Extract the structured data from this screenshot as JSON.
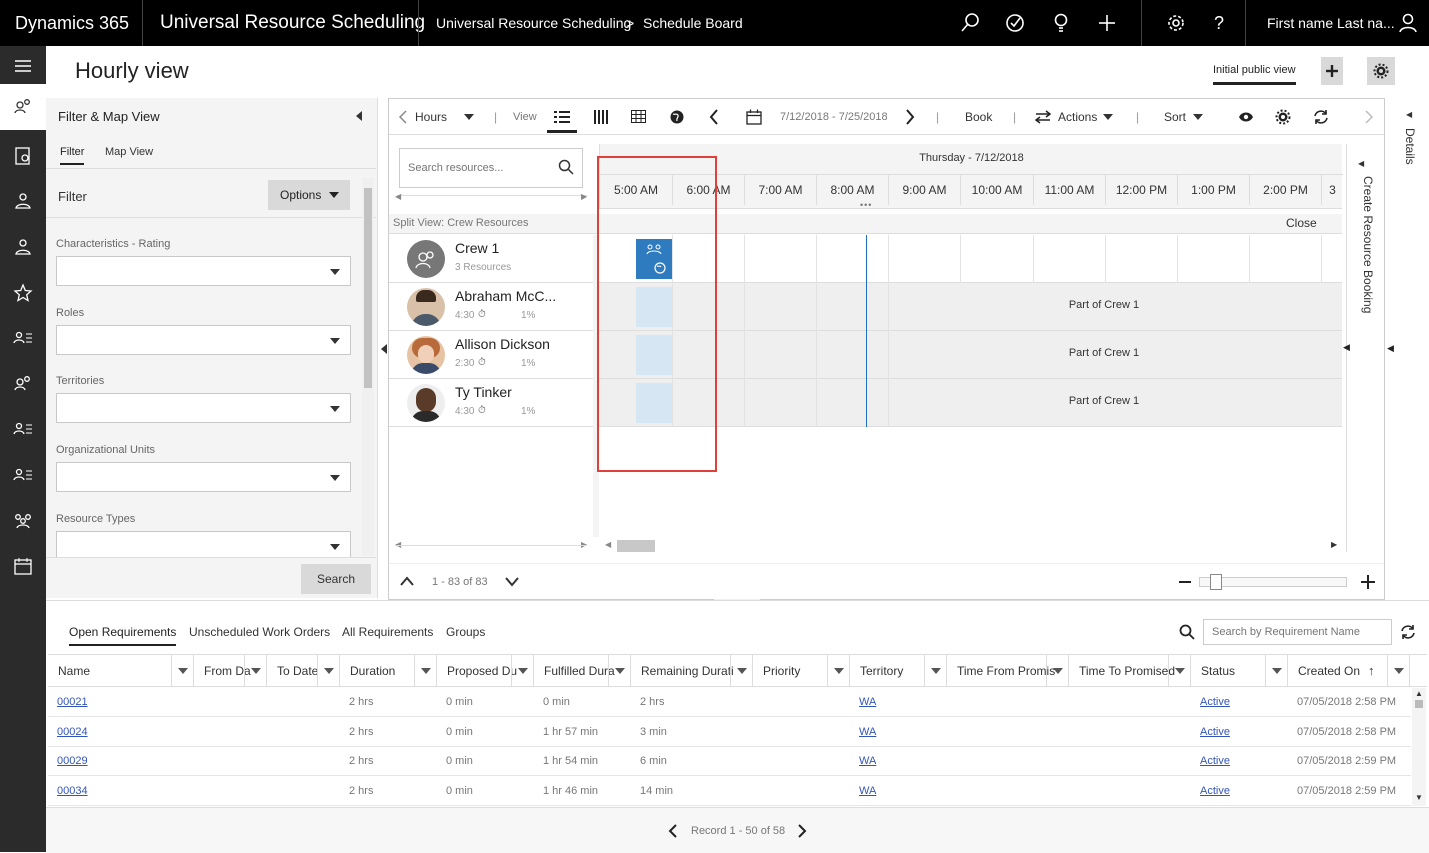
{
  "topbar": {
    "brand": "Dynamics 365",
    "app": "Universal Resource Scheduling",
    "crumb1": "Universal Resource Scheduling",
    "crumb_sep": ">",
    "crumb2": "Schedule Board",
    "user": "First name Last na..."
  },
  "header": {
    "title": "Hourly view",
    "view_tab": "Initial public view"
  },
  "filter_panel": {
    "title": "Filter & Map View",
    "tabs": [
      "Filter",
      "Map View"
    ],
    "filter_label": "Filter",
    "options_label": "Options",
    "fields": [
      "Characteristics - Rating",
      "Roles",
      "Territories",
      "Organizational Units",
      "Resource Types"
    ],
    "search_label": "Search"
  },
  "toolbar": {
    "hours": "Hours",
    "view": "View",
    "date_range": "7/12/2018 - 7/25/2018",
    "book": "Book",
    "actions": "Actions",
    "sort": "Sort"
  },
  "board": {
    "search_placeholder": "Search resources...",
    "date_header": "Thursday - 7/12/2018",
    "hours": [
      "5:00 AM",
      "6:00 AM",
      "7:00 AM",
      "8:00 AM",
      "9:00 AM",
      "10:00 AM",
      "11:00 AM",
      "12:00 PM",
      "1:00 PM",
      "2:00 PM",
      "3"
    ],
    "split_view": "Split View: Crew Resources",
    "close": "Close",
    "resources": [
      {
        "name": "Crew 1",
        "sub": "3 Resources",
        "pct": ""
      },
      {
        "name": "Abraham McC...",
        "sub": "4:30",
        "pct": "1%"
      },
      {
        "name": "Allison Dickson",
        "sub": "2:30",
        "pct": "1%"
      },
      {
        "name": "Ty Tinker",
        "sub": "4:30",
        "pct": "1%"
      }
    ],
    "crew_text": "Part of Crew 1",
    "paging": "1 - 83 of 83",
    "side_panel": "Create Resource Booking",
    "details": "Details"
  },
  "requirements": {
    "tabs": [
      "Open Requirements",
      "Unscheduled Work Orders",
      "All Requirements",
      "Groups"
    ],
    "search_placeholder": "Search by Requirement Name",
    "columns": [
      "Name",
      "From Da",
      "To Date",
      "Duration",
      "Proposed Du",
      "Fulfilled Dura",
      "Remaining Durati",
      "Priority",
      "Territory",
      "Time From Promis",
      "Time To Promised",
      "Status",
      "Created On"
    ],
    "rows": [
      {
        "name": "00021",
        "duration": "2 hrs",
        "proposed": "0 min",
        "fulfilled": "0 min",
        "remaining": "2 hrs",
        "territory": "WA",
        "status": "Active",
        "created": "07/05/2018 2:58 PM"
      },
      {
        "name": "00024",
        "duration": "2 hrs",
        "proposed": "0 min",
        "fulfilled": "1 hr 57 min",
        "remaining": "3 min",
        "territory": "WA",
        "status": "Active",
        "created": "07/05/2018 2:58 PM"
      },
      {
        "name": "00029",
        "duration": "2 hrs",
        "proposed": "0 min",
        "fulfilled": "1 hr 54 min",
        "remaining": "6 min",
        "territory": "WA",
        "status": "Active",
        "created": "07/05/2018 2:59 PM"
      },
      {
        "name": "00034",
        "duration": "2 hrs",
        "proposed": "0 min",
        "fulfilled": "1 hr 46 min",
        "remaining": "14 min",
        "territory": "WA",
        "status": "Active",
        "created": "07/05/2018 2:59 PM"
      }
    ],
    "record": "Record 1 - 50 of 58"
  },
  "colors": {
    "topbar": "#000000",
    "leftnav": "#2b2b2b",
    "booking": "#2e7bbf",
    "highlight": "#e0403a",
    "now_line": "#1f6fbf"
  }
}
